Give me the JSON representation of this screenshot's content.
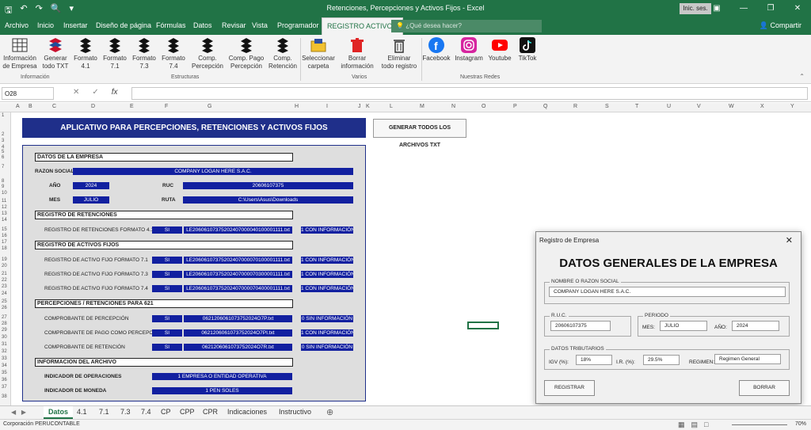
{
  "window": {
    "title": "Retenciones, Percepciones y Activos Fijos  -  Excel",
    "sign_in": "Inic. ses."
  },
  "ribbon_tabs": [
    "Archivo",
    "Inicio",
    "Insertar",
    "Diseño de página",
    "Fórmulas",
    "Datos",
    "Revisar",
    "Vista",
    "Programador",
    "REGISTRO ACTIVOS"
  ],
  "search_placeholder": "¿Qué desea hacer?",
  "share_label": "Compartir",
  "ribbon": {
    "buttons": [
      {
        "l1": "Información",
        "l2": "de Empresa",
        "icon": "table-icon"
      },
      {
        "l1": "Generar",
        "l2": "todo TXT",
        "icon": "sunat-logo-icon"
      },
      {
        "l1": "Formato",
        "l2": "4.1",
        "icon": "s-logo-icon"
      },
      {
        "l1": "Formato",
        "l2": "7.1",
        "icon": "s-logo-icon"
      },
      {
        "l1": "Formato",
        "l2": "7.3",
        "icon": "s-logo-icon"
      },
      {
        "l1": "Formato",
        "l2": "7.4",
        "icon": "s-logo-icon"
      },
      {
        "l1": "Comp.",
        "l2": "Percepción",
        "icon": "s-logo-icon"
      },
      {
        "l1": "Comp. Pago",
        "l2": "Percepción",
        "icon": "s-logo-icon"
      },
      {
        "l1": "Comp.",
        "l2": "Retención",
        "icon": "s-logo-icon"
      },
      {
        "l1": "Seleccionar",
        "l2": "carpeta",
        "icon": "folder-icon"
      },
      {
        "l1": "Borrar",
        "l2": "información",
        "icon": "trash-icon"
      },
      {
        "l1": "Eliminar",
        "l2": "todo registro",
        "icon": "delete-bin-icon"
      },
      {
        "l1": "Facebook",
        "l2": "",
        "icon": "facebook-icon"
      },
      {
        "l1": "Instagram",
        "l2": "",
        "icon": "instagram-icon"
      },
      {
        "l1": "Youtube",
        "l2": "",
        "icon": "youtube-icon"
      },
      {
        "l1": "TikTok",
        "l2": "",
        "icon": "tiktok-icon"
      }
    ],
    "groups": [
      "Información",
      "Estructuras",
      "Varios",
      "Nuestras Redes"
    ]
  },
  "name_box": "O28",
  "columns": [
    "A",
    "B",
    "C",
    "D",
    "E",
    "F",
    "G",
    "H",
    "I",
    "J",
    "K",
    "L",
    "M",
    "N",
    "O",
    "P",
    "Q",
    "R",
    "S",
    "T",
    "U",
    "V",
    "W",
    "X",
    "Y"
  ],
  "rows": [
    "1",
    "2",
    "3",
    "4",
    "5",
    "6",
    "7",
    "8",
    "9",
    "10",
    "11",
    "12",
    "13",
    "14",
    "15",
    "16",
    "17",
    "18",
    "19",
    "20",
    "21",
    "22",
    "23",
    "24",
    "25",
    "26",
    "27",
    "28",
    "29",
    "30",
    "31",
    "32",
    "33",
    "34",
    "35",
    "36",
    "37",
    "38"
  ],
  "sheet": {
    "banner": "APLICATIVO PARA PERCEPCIONES, RETENCIONES Y ACTIVOS FIJOS",
    "generate_all": "GENERAR TODOS LOS ARCHIVOS TXT",
    "sec_empresa": "DATOS DE LA EMPRESA",
    "razon_label": "RAZON SOCIAL",
    "razon_value": "COMPANY LOGAN HERE S.A.C.",
    "anio_label": "AÑO",
    "anio_value": "2024",
    "ruc_label": "RUC",
    "ruc_value": "20606107375",
    "mes_label": "MES",
    "mes_value": "JULIO",
    "ruta_label": "RUTA",
    "ruta_value": "C:\\Users\\Asus\\Downloads",
    "sec_retenciones": "REGISTRO DE RETENCIONES",
    "sec_activos": "REGISTRO DE ACTIVOS FIJOS",
    "sec_percepciones": "PERCEPCIONES / RETENCIONES PARA 621",
    "sec_info": "INFORMACION DEL ARCHIVO",
    "registros": [
      {
        "label": "REGISTRO DE RETENCIONES FORMATO 4.1",
        "flag": "SI",
        "file": "LE20606107375202407000040100001111.txt",
        "status": "1 CON INFORMACIÓN"
      },
      {
        "label": "REGISTRO DE ACTIVO FIJO FORMATO 7.1",
        "flag": "SI",
        "file": "LE20606107375202407000070100001111.txt",
        "status": "1 CON INFORMACIÓN"
      },
      {
        "label": "REGISTRO DE ACTIVO FIJO FORMATO 7.3",
        "flag": "SI",
        "file": "LE20606107375202407000070300001111.txt",
        "status": "1 CON INFORMACIÓN"
      },
      {
        "label": "REGISTRO DE ACTIVO FIJO FORMATO 7.4",
        "flag": "SI",
        "file": "LE20606107375202407000070400001111.txt",
        "status": "1 CON INFORMACIÓN"
      },
      {
        "label": "COMPROBANTE DE PERCEPCIÓN",
        "flag": "SI",
        "file": "0621206061073752024O7P.txt",
        "status": "0 SIN INFORMACIÓN"
      },
      {
        "label": "COMPROBANTE DE PAGO COMO PERCEPCIÓN",
        "flag": "SI",
        "file": "0621206061073752024O7PI.txt",
        "status": "1 CON INFORMACIÓN"
      },
      {
        "label": "COMPROBANTE DE RETENCIÓN",
        "flag": "SI",
        "file": "0621206061073752024O7R.txt",
        "status": "0 SIN INFORMACIÓN"
      }
    ],
    "ind_oper_label": "INDICADOR DE OPERACIONES",
    "ind_oper_value": "1 EMPRESA O ENTIDAD OPERATIVA",
    "ind_moneda_label": "INDICADOR DE MONEDA",
    "ind_moneda_value": "1 PEN SOLES"
  },
  "sheet_tabs": [
    "Datos",
    "4.1",
    "7.1",
    "7.3",
    "7.4",
    "CP",
    "CPP",
    "CPR",
    "Indicaciones",
    "Instructivo"
  ],
  "status_text": "Corporación PERUCONTABLE",
  "zoom": "70%",
  "dialog": {
    "title": "Registro de Empresa",
    "heading": "DATOS GENERALES DE LA EMPRESA",
    "frame_nombre": "NOMBRE O RAZON SOCIAL",
    "nombre_value": "COMPANY LOGAN HERE S.A.C.",
    "frame_ruc": "R.U.C.",
    "ruc_value": "20606107375",
    "frame_periodo": "PERIODO",
    "mes_label": "MES:",
    "mes_value": "JULIO",
    "anio_label": "AÑO:",
    "anio_value": "2024",
    "frame_trib": "DATOS TRIBUTARIOS",
    "igv_label": "IGV (%):",
    "igv_value": "18%",
    "ir_label": "I.R. (%):",
    "ir_value": "29.5%",
    "regimen_label": "REGIMEN:",
    "regimen_value": "Regimen General",
    "registrar": "REGISTRAR",
    "borrar": "BORRAR"
  },
  "colors": {
    "excel_green": "#217346",
    "banner_blue": "#1f2f8a",
    "cell_blue": "#1220a0"
  }
}
